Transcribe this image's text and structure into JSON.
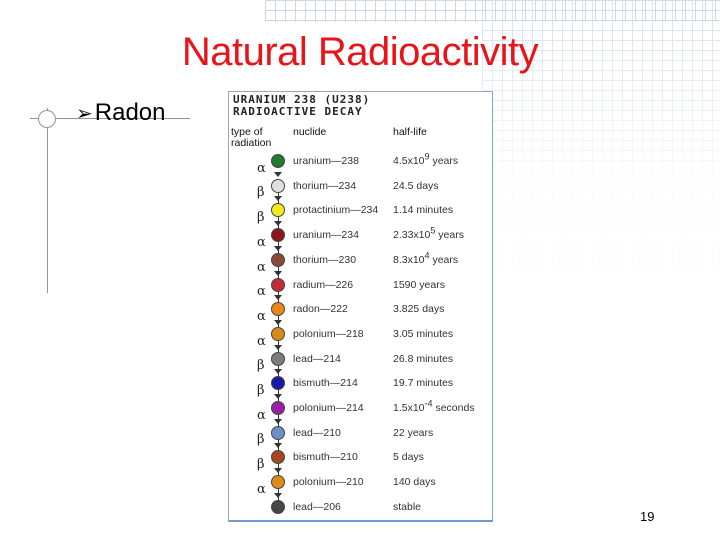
{
  "slide": {
    "title": "Natural Radioactivity",
    "bullet": "Radon",
    "page_number": "19"
  },
  "figure": {
    "heading_line1": "URANIUM 238 (U238)",
    "heading_line2": "RADIOACTIVE DECAY",
    "col_type": "type of radiation",
    "col_type_1": "type of",
    "col_type_2": "radiation",
    "col_nuclide": "nuclide",
    "col_halflife": "half-life",
    "rows": [
      {
        "radiation": "",
        "nuclide": "uranium—238",
        "half_life": "4.5x10",
        "sup": "9",
        "tail": " years",
        "color": "#1e7a2e"
      },
      {
        "radiation": "α",
        "nuclide": "thorium—234",
        "half_life": "24.5 days",
        "sup": "",
        "tail": "",
        "color": "#e0e0e0"
      },
      {
        "radiation": "β",
        "nuclide": "protactinium—234",
        "half_life": "1.14 minutes",
        "sup": "",
        "tail": "",
        "color": "#f2ea1a"
      },
      {
        "radiation": "β",
        "nuclide": "uranium—234",
        "half_life": "2.33x10",
        "sup": "5",
        "tail": " years",
        "color": "#8a1622"
      },
      {
        "radiation": "α",
        "nuclide": "thorium—230",
        "half_life": "8.3x10",
        "sup": "4",
        "tail": " years",
        "color": "#8a4a3a"
      },
      {
        "radiation": "α",
        "nuclide": "radium—226",
        "half_life": "1590 years",
        "sup": "",
        "tail": "",
        "color": "#c22b3a"
      },
      {
        "radiation": "α",
        "nuclide": "radon—222",
        "half_life": "3.825 days",
        "sup": "",
        "tail": "",
        "color": "#e8861a"
      },
      {
        "radiation": "α",
        "nuclide": "polonium—218",
        "half_life": "3.05 minutes",
        "sup": "",
        "tail": "",
        "color": "#d88a1a"
      },
      {
        "radiation": "α",
        "nuclide": "lead—214",
        "half_life": "26.8 minutes",
        "sup": "",
        "tail": "",
        "color": "#7c7c7c"
      },
      {
        "radiation": "β",
        "nuclide": "bismuth—214",
        "half_life": "19.7 minutes",
        "sup": "",
        "tail": "",
        "color": "#1a1aa8"
      },
      {
        "radiation": "β",
        "nuclide": "polonium—214",
        "half_life": "1.5x10",
        "sup": "-4",
        "tail": " seconds",
        "color": "#9a1ea8"
      },
      {
        "radiation": "α",
        "nuclide": "lead—210",
        "half_life": "22 years",
        "sup": "",
        "tail": "",
        "color": "#6e8ec8"
      },
      {
        "radiation": "β",
        "nuclide": "bismuth—210",
        "half_life": "5 days",
        "sup": "",
        "tail": "",
        "color": "#a6481e"
      },
      {
        "radiation": "β",
        "nuclide": "polonium—210",
        "half_life": "140 days",
        "sup": "",
        "tail": "",
        "color": "#e08a1a"
      },
      {
        "radiation": "α",
        "nuclide": "lead—206",
        "half_life": "stable",
        "sup": "",
        "tail": "",
        "color": "#454545"
      }
    ]
  }
}
